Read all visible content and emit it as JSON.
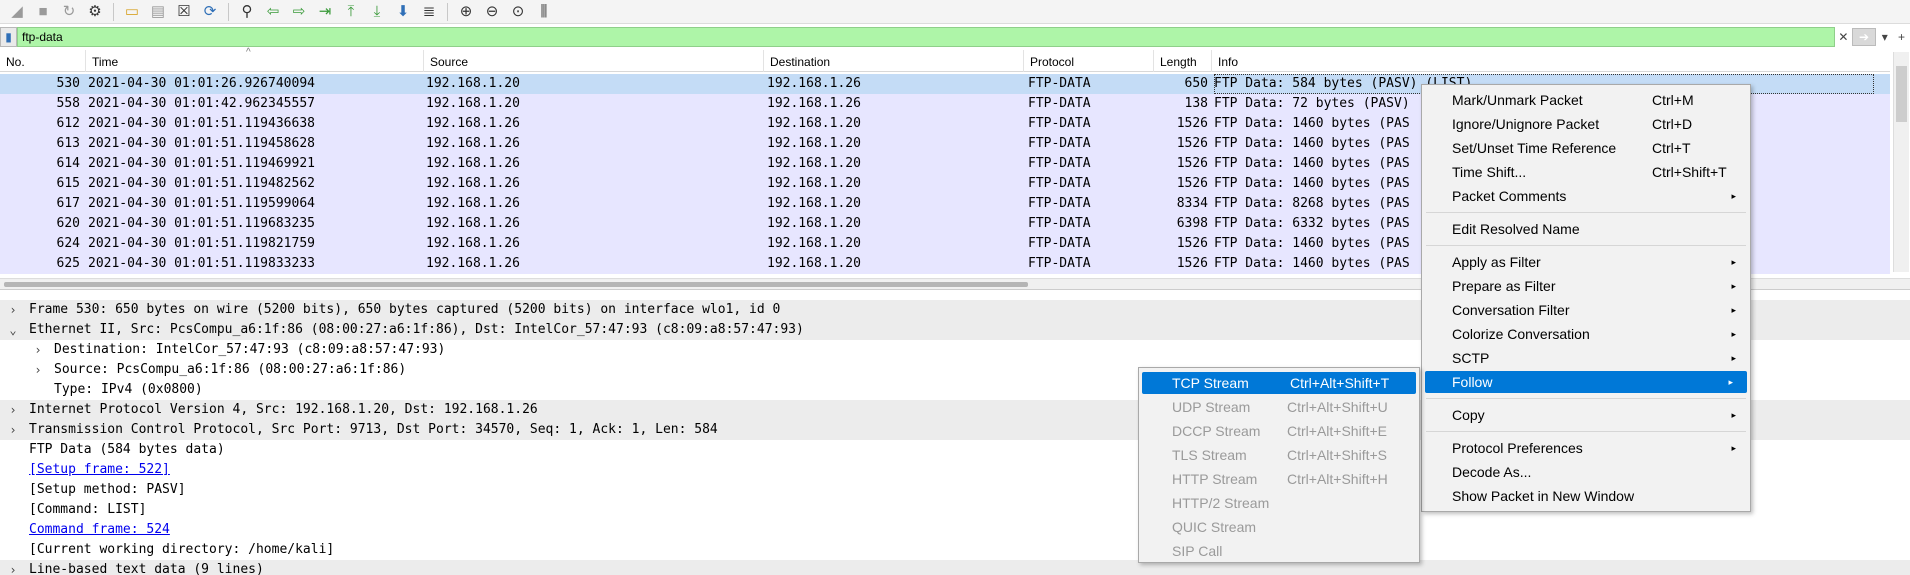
{
  "toolbar": {
    "icons": [
      "shark-fin-start-icon",
      "stop-capture-icon",
      "restart-capture-icon",
      "capture-options-icon",
      "open-file-icon",
      "save-file-icon",
      "close-file-icon",
      "reload-file-icon",
      "find-packet-icon",
      "go-back-icon",
      "go-forward-icon",
      "go-to-packet-icon",
      "first-packet-icon",
      "last-packet-icon",
      "autoscroll-icon",
      "colorize-icon",
      "zoom-in-icon",
      "zoom-out-icon",
      "zoom-normal-icon",
      "resize-columns-icon"
    ]
  },
  "filter": {
    "value": "ftp-data",
    "bookmark_icon": "bookmark-icon",
    "clear_icon": "clear-filter-icon",
    "apply_icon": "apply-filter-icon",
    "dropdown_icon": "chevron-down-icon",
    "add_icon": "add-filter-button-icon",
    "add_label": "+",
    "dropdown_label": "▾",
    "clear_label": "✕"
  },
  "packet_list": {
    "columns": [
      "No.",
      "Time",
      "Source",
      "Destination",
      "Protocol",
      "Length",
      "Info"
    ],
    "sort_caret": "^",
    "rows": [
      {
        "no": "530",
        "time": "2021-04-30 01:01:26.926740094",
        "src": "192.168.1.20",
        "dst": "192.168.1.26",
        "proto": "FTP-DATA",
        "len": "650",
        "info": "FTP Data: 584 bytes (PASV) (LIST)"
      },
      {
        "no": "558",
        "time": "2021-04-30 01:01:42.962345557",
        "src": "192.168.1.20",
        "dst": "192.168.1.26",
        "proto": "FTP-DATA",
        "len": "138",
        "info": "FTP Data: 72 bytes (PASV)"
      },
      {
        "no": "612",
        "time": "2021-04-30 01:01:51.119436638",
        "src": "192.168.1.26",
        "dst": "192.168.1.20",
        "proto": "FTP-DATA",
        "len": "1526",
        "info": "FTP Data: 1460 bytes (PAS"
      },
      {
        "no": "613",
        "time": "2021-04-30 01:01:51.119458628",
        "src": "192.168.1.26",
        "dst": "192.168.1.20",
        "proto": "FTP-DATA",
        "len": "1526",
        "info": "FTP Data: 1460 bytes (PAS"
      },
      {
        "no": "614",
        "time": "2021-04-30 01:01:51.119469921",
        "src": "192.168.1.26",
        "dst": "192.168.1.20",
        "proto": "FTP-DATA",
        "len": "1526",
        "info": "FTP Data: 1460 bytes (PAS"
      },
      {
        "no": "615",
        "time": "2021-04-30 01:01:51.119482562",
        "src": "192.168.1.26",
        "dst": "192.168.1.20",
        "proto": "FTP-DATA",
        "len": "1526",
        "info": "FTP Data: 1460 bytes (PAS"
      },
      {
        "no": "617",
        "time": "2021-04-30 01:01:51.119599064",
        "src": "192.168.1.26",
        "dst": "192.168.1.20",
        "proto": "FTP-DATA",
        "len": "8334",
        "info": "FTP Data: 8268 bytes (PAS"
      },
      {
        "no": "620",
        "time": "2021-04-30 01:01:51.119683235",
        "src": "192.168.1.26",
        "dst": "192.168.1.20",
        "proto": "FTP-DATA",
        "len": "6398",
        "info": "FTP Data: 6332 bytes (PAS"
      },
      {
        "no": "624",
        "time": "2021-04-30 01:01:51.119821759",
        "src": "192.168.1.26",
        "dst": "192.168.1.20",
        "proto": "FTP-DATA",
        "len": "1526",
        "info": "FTP Data: 1460 bytes (PAS"
      },
      {
        "no": "625",
        "time": "2021-04-30 01:01:51.119833233",
        "src": "192.168.1.26",
        "dst": "192.168.1.20",
        "proto": "FTP-DATA",
        "len": "1526",
        "info": "FTP Data: 1460 bytes (PAS"
      }
    ]
  },
  "details": {
    "lines": [
      {
        "arrow": "›",
        "text": "Frame 530: 650 bytes on wire (5200 bits), 650 bytes captured (5200 bits) on interface wlo1, id 0"
      },
      {
        "arrow": "⌄",
        "text": "Ethernet II, Src: PcsCompu_a6:1f:86 (08:00:27:a6:1f:86), Dst: IntelCor_57:47:93 (c8:09:a8:57:47:93)"
      },
      {
        "arrow": "›",
        "text": "Destination: IntelCor_57:47:93 (c8:09:a8:57:47:93)"
      },
      {
        "arrow": "›",
        "text": "Source: PcsCompu_a6:1f:86 (08:00:27:a6:1f:86)"
      },
      {
        "arrow": "",
        "text": "Type: IPv4 (0x0800)"
      },
      {
        "arrow": "›",
        "text": "Internet Protocol Version 4, Src: 192.168.1.20, Dst: 192.168.1.26"
      },
      {
        "arrow": "›",
        "text": "Transmission Control Protocol, Src Port: 9713, Dst Port: 34570, Seq: 1, Ack: 1, Len: 584"
      },
      {
        "arrow": "",
        "text": "FTP Data (584 bytes data)"
      },
      {
        "arrow": "",
        "text": "[Setup frame: 522]"
      },
      {
        "arrow": "",
        "text": "[Setup method: PASV]"
      },
      {
        "arrow": "",
        "text": "[Command: LIST]"
      },
      {
        "arrow": "",
        "text": "Command frame: 524"
      },
      {
        "arrow": "",
        "text": "[Current working directory: /home/kali]"
      },
      {
        "arrow": "›",
        "text": "Line-based text data (9 lines)"
      }
    ]
  },
  "context_menu": {
    "items": [
      {
        "label": "Mark/Unmark Packet",
        "shortcut": "Ctrl+M",
        "submenu": false
      },
      {
        "label": "Ignore/Unignore Packet",
        "shortcut": "Ctrl+D",
        "submenu": false
      },
      {
        "label": "Set/Unset Time Reference",
        "shortcut": "Ctrl+T",
        "submenu": false
      },
      {
        "label": "Time Shift...",
        "shortcut": "Ctrl+Shift+T",
        "submenu": false
      },
      {
        "label": "Packet Comments",
        "shortcut": "",
        "submenu": true
      },
      {
        "label": "Edit Resolved Name",
        "shortcut": "",
        "submenu": false
      },
      {
        "label": "Apply as Filter",
        "shortcut": "",
        "submenu": true
      },
      {
        "label": "Prepare as Filter",
        "shortcut": "",
        "submenu": true
      },
      {
        "label": "Conversation Filter",
        "shortcut": "",
        "submenu": true
      },
      {
        "label": "Colorize Conversation",
        "shortcut": "",
        "submenu": true
      },
      {
        "label": "SCTP",
        "shortcut": "",
        "submenu": true
      },
      {
        "label": "Follow",
        "shortcut": "",
        "submenu": true
      },
      {
        "label": "Copy",
        "shortcut": "",
        "submenu": true
      },
      {
        "label": "Protocol Preferences",
        "shortcut": "",
        "submenu": true
      },
      {
        "label": "Decode As...",
        "shortcut": "",
        "submenu": false
      },
      {
        "label": "Show Packet in New Window",
        "shortcut": "",
        "submenu": false
      }
    ],
    "submenu_arrow": "▸"
  },
  "follow_submenu": {
    "items": [
      {
        "label": "TCP Stream",
        "shortcut": "Ctrl+Alt+Shift+T"
      },
      {
        "label": "UDP Stream",
        "shortcut": "Ctrl+Alt+Shift+U"
      },
      {
        "label": "DCCP Stream",
        "shortcut": "Ctrl+Alt+Shift+E"
      },
      {
        "label": "TLS Stream",
        "shortcut": "Ctrl+Alt+Shift+S"
      },
      {
        "label": "HTTP Stream",
        "shortcut": "Ctrl+Alt+Shift+H"
      },
      {
        "label": "HTTP/2 Stream",
        "shortcut": ""
      },
      {
        "label": "QUIC Stream",
        "shortcut": ""
      },
      {
        "label": "SIP Call",
        "shortcut": ""
      }
    ]
  },
  "colors": {
    "filter_valid": "#aef5a8",
    "row_bg": "#e7e6ff",
    "row_selected": "#c4dcf6",
    "menu_highlight": "#0078d7"
  }
}
